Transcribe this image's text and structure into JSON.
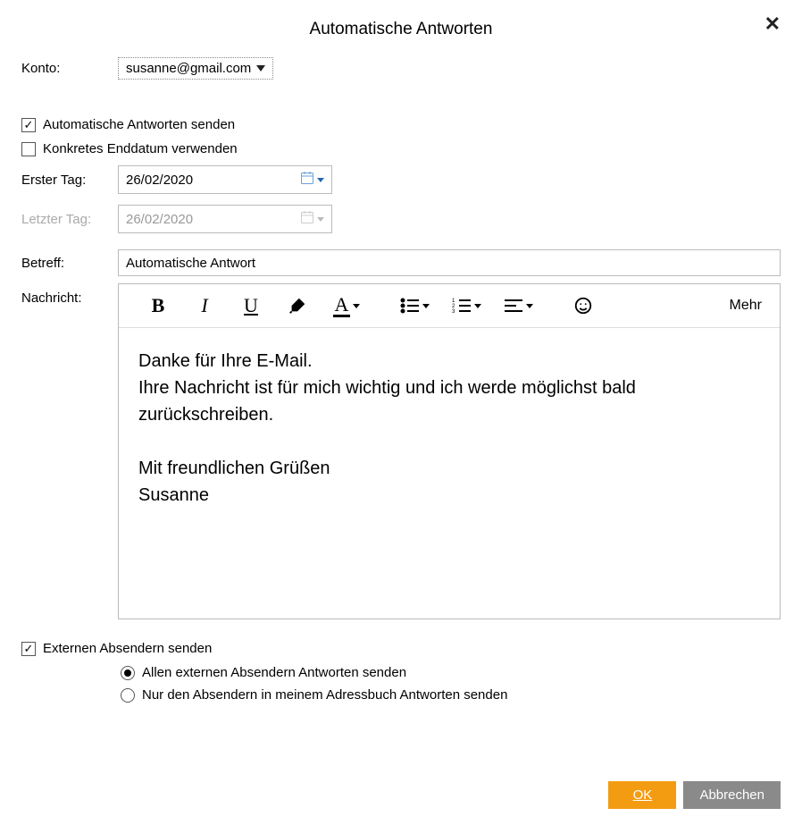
{
  "title": "Automatische Antworten",
  "labels": {
    "account": "Konto:",
    "send_auto": "Automatische Antworten senden",
    "use_enddate": "Konkretes Enddatum verwenden",
    "first_day": "Erster Tag:",
    "last_day": "Letzter Tag:",
    "subject": "Betreff:",
    "message": "Nachricht:",
    "send_external": "Externen Absendern senden",
    "radio_all": "Allen externen Absendern Antworten senden",
    "radio_book": "Nur den Absendern in meinem Adressbuch Antworten senden"
  },
  "account": "susanne@gmail.com",
  "send_auto_checked": true,
  "use_enddate_checked": false,
  "first_day": "26/02/2020",
  "last_day": "26/02/2020",
  "subject": "Automatische Antwort",
  "message": "Danke für Ihre E-Mail.\nIhre Nachricht ist für mich wichtig und ich werde möglichst bald zurückschreiben.\n\nMit freundlichen Grüßen\nSusanne",
  "toolbar": {
    "more": "Mehr"
  },
  "send_external_checked": true,
  "external_radio_all_selected": true,
  "buttons": {
    "ok": "OK",
    "cancel": "Abbrechen"
  }
}
